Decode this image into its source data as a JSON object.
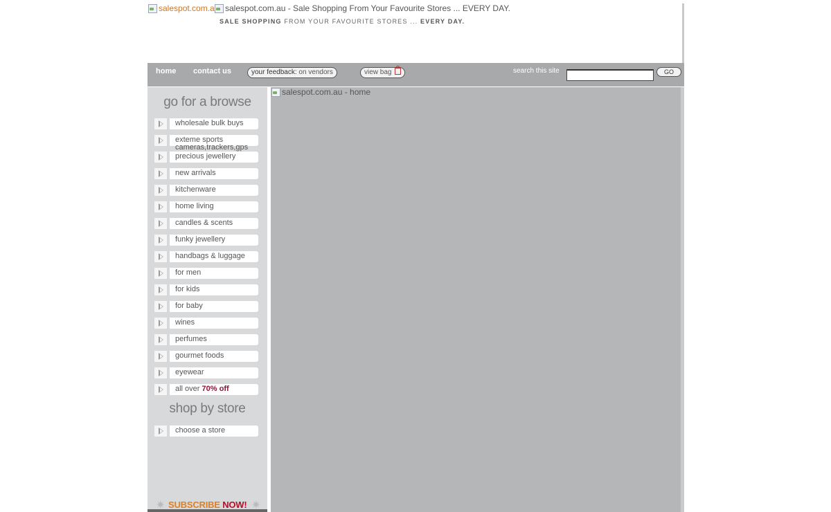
{
  "header": {
    "logo_alt": "salespot.com.au",
    "title_alt": "salespot.com.au - Sale Shopping From Your Favourite Stores ... EVERY DAY.",
    "tagline_a": "SALE SHOPPING",
    "tagline_b": " FROM YOUR FAVOURITE STORES ... ",
    "tagline_c": "EVERY DAY."
  },
  "nav": {
    "home": "home",
    "contact": "contact us",
    "feedback_a": "your feedback:",
    "feedback_b": " on vendors",
    "view_bag": "view bag",
    "search_label": "search this site",
    "search_value": "",
    "go": "GO"
  },
  "sidebar": {
    "browse_heading": "go for a browse",
    "items": [
      {
        "label": "wholesale bulk buys"
      },
      {
        "label": "exteme sports",
        "sub": "cameras,trackers,gps"
      },
      {
        "label": "precious jewellery"
      },
      {
        "label": "new arrivals"
      },
      {
        "label": "kitchenware"
      },
      {
        "label": "home living"
      },
      {
        "label": "candles & scents"
      },
      {
        "label": "funky jewellery"
      },
      {
        "label": "handbags & luggage"
      },
      {
        "label": "for men"
      },
      {
        "label": "for kids"
      },
      {
        "label": "for baby"
      },
      {
        "label": "wines"
      },
      {
        "label": "perfumes"
      },
      {
        "label": "gourmet foods"
      },
      {
        "label": "eyewear"
      }
    ],
    "sale_prefix": "all over ",
    "sale_highlight": "70% off",
    "store_heading": "shop by store",
    "choose_store": "choose a store",
    "subscribe_a": "SUBSCRIBE ",
    "subscribe_b": "NOW!"
  },
  "main": {
    "image_alt": "salespot.com.au - home"
  },
  "colors": {
    "nav_bg": "#a8a9ab",
    "sidebar_bg": "#d8d9da",
    "main_bg": "#b5b6b8",
    "sale_highlight": "#8b1535",
    "subscribe": "#e0801f"
  }
}
